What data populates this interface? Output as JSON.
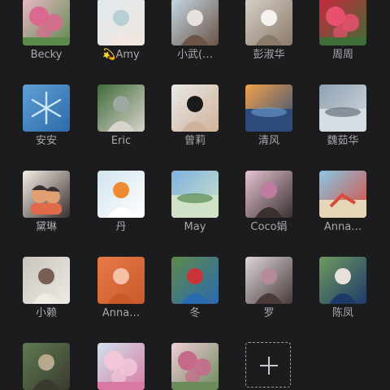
{
  "contacts": [
    {
      "name": "Becky",
      "icon": "flower-photo-icon",
      "colors": [
        "#e9b8c6",
        "#d9698e",
        "#5c8a4a"
      ]
    },
    {
      "name": "💫Amy",
      "icon": "portrait-photo-icon",
      "colors": [
        "#dfe9ec",
        "#b9cfd6",
        "#f2e6e0"
      ]
    },
    {
      "name": "小武(…",
      "icon": "portrait-photo-icon",
      "colors": [
        "#c4d8e4",
        "#e9e2dc",
        "#6b5347"
      ]
    },
    {
      "name": "彭淑华",
      "icon": "portrait-photo-icon",
      "colors": [
        "#d8d0c8",
        "#f4f1ee",
        "#8a7a6a"
      ]
    },
    {
      "name": "周周",
      "icon": "flower-photo-icon",
      "colors": [
        "#c8283c",
        "#e85070",
        "#3f6d35"
      ]
    },
    {
      "name": "安安",
      "icon": "snowflake-photo-icon",
      "colors": [
        "#5f9fd6",
        "#cfe6f6",
        "#2e6aa8"
      ]
    },
    {
      "name": "Eric",
      "icon": "portrait-photo-icon",
      "colors": [
        "#3f6b3b",
        "#a0a8a4",
        "#d9d4cb"
      ]
    },
    {
      "name": "曾莉",
      "icon": "portrait-photo-icon",
      "colors": [
        "#e8e8e6",
        "#1a1a1a",
        "#d0b29a"
      ]
    },
    {
      "name": "清风",
      "icon": "landscape-photo-icon",
      "colors": [
        "#f1a24a",
        "#6a9fd0",
        "#2e4a7a"
      ]
    },
    {
      "name": "魏茹华",
      "icon": "landscape-photo-icon",
      "colors": [
        "#8fa1b1",
        "#55606b",
        "#d6dde2"
      ]
    },
    {
      "name": "黛琳",
      "icon": "cartoon-photo-icon",
      "colors": [
        "#f6efe6",
        "#e0a070",
        "#3a3030"
      ]
    },
    {
      "name": "丹",
      "icon": "portrait-photo-icon",
      "colors": [
        "#d2e4ee",
        "#f08a30",
        "#ffffff"
      ]
    },
    {
      "name": "May",
      "icon": "landscape-photo-icon",
      "colors": [
        "#7fb2e0",
        "#3f7a3a",
        "#cfe2c8"
      ]
    },
    {
      "name": "Coco娟",
      "icon": "portrait-photo-icon",
      "colors": [
        "#e7c4d4",
        "#c07ba0",
        "#3a3030"
      ]
    },
    {
      "name": "Anna…",
      "icon": "beach-photo-icon",
      "colors": [
        "#89c8e6",
        "#e6d6b8",
        "#d84a3a"
      ]
    },
    {
      "name": "小赖",
      "icon": "portrait-photo-icon",
      "colors": [
        "#c9c4bd",
        "#7a5e54",
        "#efeae4"
      ]
    },
    {
      "name": "Anna…",
      "icon": "portrait-photo-icon",
      "colors": [
        "#e87a4a",
        "#f3c2a6",
        "#c85a2a"
      ]
    },
    {
      "name": "冬",
      "icon": "portrait-photo-icon",
      "colors": [
        "#5f8a4a",
        "#c8343a",
        "#2a6ab0"
      ]
    },
    {
      "name": "罗",
      "icon": "portrait-photo-icon",
      "colors": [
        "#dcd6d8",
        "#b58a9a",
        "#4a3a3a"
      ]
    },
    {
      "name": "陈凤",
      "icon": "portrait-photo-icon",
      "colors": [
        "#6f9a5e",
        "#e8e0da",
        "#1e3a6a"
      ]
    },
    {
      "name": "",
      "icon": "portrait-photo-icon",
      "colors": [
        "#5e7a52",
        "#b8a88e",
        "#3a3a2e"
      ]
    },
    {
      "name": "",
      "icon": "flower-photo-icon",
      "colors": [
        "#cfe3f0",
        "#f3c6d8",
        "#d97aa2"
      ]
    },
    {
      "name": "",
      "icon": "flower-photo-icon",
      "colors": [
        "#f0cdd8",
        "#c66a8a",
        "#6a8a5a"
      ]
    }
  ],
  "add_button": {
    "icon": "plus-icon"
  }
}
